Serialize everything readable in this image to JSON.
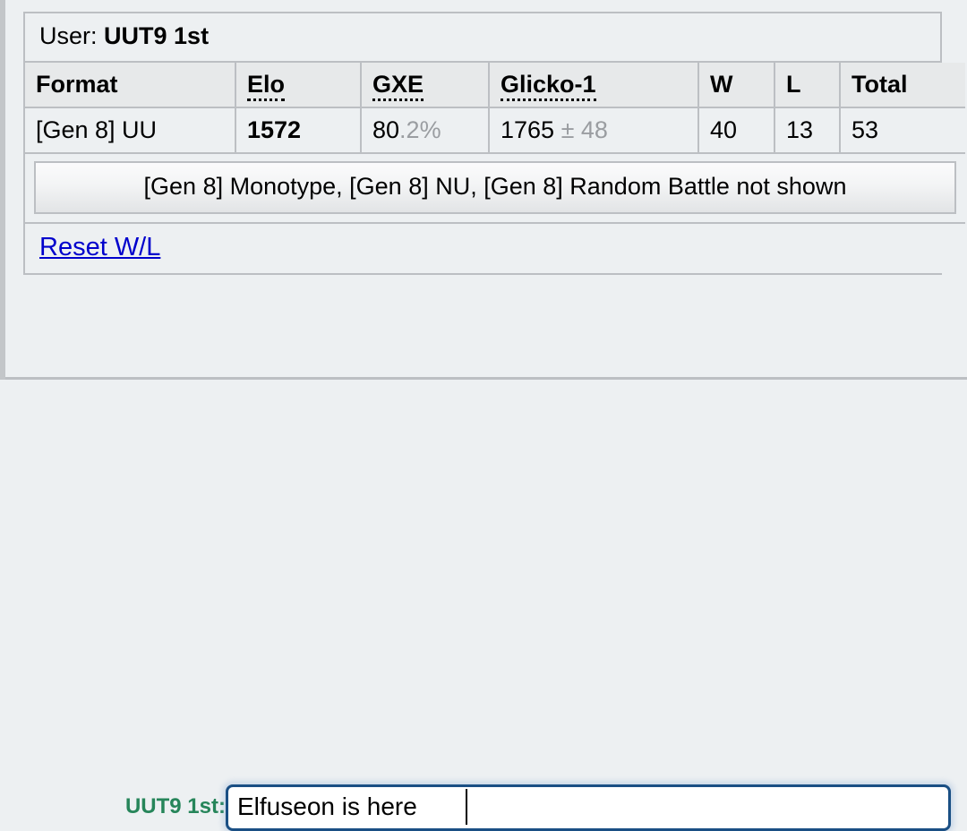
{
  "panel": {
    "user_label": "User:",
    "user_name": "UUT9 1st",
    "table": {
      "headers": [
        "Format",
        "Elo",
        "GXE",
        "Glicko-1",
        "W",
        "L",
        "Total"
      ],
      "rows": [
        {
          "format": "[Gen 8] UU",
          "elo": "1572",
          "gxe_main": "80",
          "gxe_decimal": ".2%",
          "glicko_main": "1765",
          "glicko_deviation": "± 48",
          "w": "40",
          "l": "13",
          "total": "53"
        }
      ]
    },
    "notice_button": "[Gen 8] Monotype, [Gen 8] NU, [Gen 8] Random Battle not shown",
    "reset_link": "Reset W/L"
  },
  "chat": {
    "username": "UUT9 1st:",
    "input_value": "Elfuseon is here",
    "input_placeholder": ""
  },
  "colors": {
    "page_background": "#edf0f2",
    "border": "#bcbfc3",
    "header_cell": "#e7e9ea",
    "muted_text": "#9a9da1",
    "link": "#0000cc",
    "username_green": "#26855a",
    "input_focus_border": "#1a4f84"
  }
}
